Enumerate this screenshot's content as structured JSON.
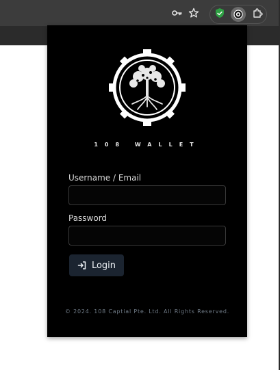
{
  "popup": {
    "brand": "108 WALLET",
    "username_label": "Username / Email",
    "username_value": "",
    "password_label": "Password",
    "password_value": "",
    "login_label": "Login",
    "footer": "© 2024. 108 Captial Pte. Ltd. All Rights Reserved."
  },
  "colors": {
    "popup_bg": "#000000",
    "button_bg": "#1b2430",
    "footer_text": "#6f7a86",
    "shield_green": "#2ea043"
  },
  "icons": {
    "password_key": "key-icon",
    "bookmark": "star-icon",
    "shield_extension": "shield-icon",
    "wallet_extension": "wallet-extension-icon",
    "extensions": "puzzle-icon",
    "login": "login-icon"
  }
}
